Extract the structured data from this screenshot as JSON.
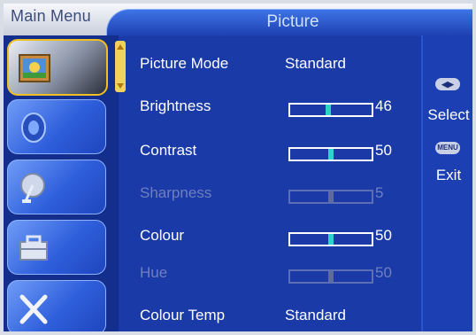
{
  "header": {
    "main_menu": "Main Menu",
    "title": "Picture"
  },
  "sidebar": {
    "items": [
      {
        "name": "picture",
        "icon": "picture-icon",
        "active": true
      },
      {
        "name": "sound",
        "icon": "speaker-icon",
        "active": false
      },
      {
        "name": "channel",
        "icon": "satellite-dish-icon",
        "active": false
      },
      {
        "name": "features",
        "icon": "toolbox-icon",
        "active": false
      },
      {
        "name": "setup",
        "icon": "tools-icon",
        "active": false
      }
    ]
  },
  "settings": {
    "picture_mode": {
      "label": "Picture Mode",
      "value": "Standard"
    },
    "brightness": {
      "label": "Brightness",
      "value": "46",
      "level": 0.46
    },
    "contrast": {
      "label": "Contrast",
      "value": "50",
      "level": 0.5
    },
    "sharpness": {
      "label": "Sharpness",
      "value": "5",
      "level": 0.5,
      "enabled": false
    },
    "colour": {
      "label": "Colour",
      "value": "50",
      "level": 0.5
    },
    "hue": {
      "label": "Hue",
      "value": "50",
      "level": 0.5,
      "enabled": false
    },
    "colour_temp": {
      "label": "Colour Temp",
      "value": "Standard"
    }
  },
  "help": {
    "select_button": "◀▶",
    "select_label": "Select",
    "menu_button": "MENU",
    "exit_label": "Exit"
  },
  "colors": {
    "background": "#1a3aa8",
    "accent": "#2dd4c8",
    "highlight": "#f0c020"
  }
}
